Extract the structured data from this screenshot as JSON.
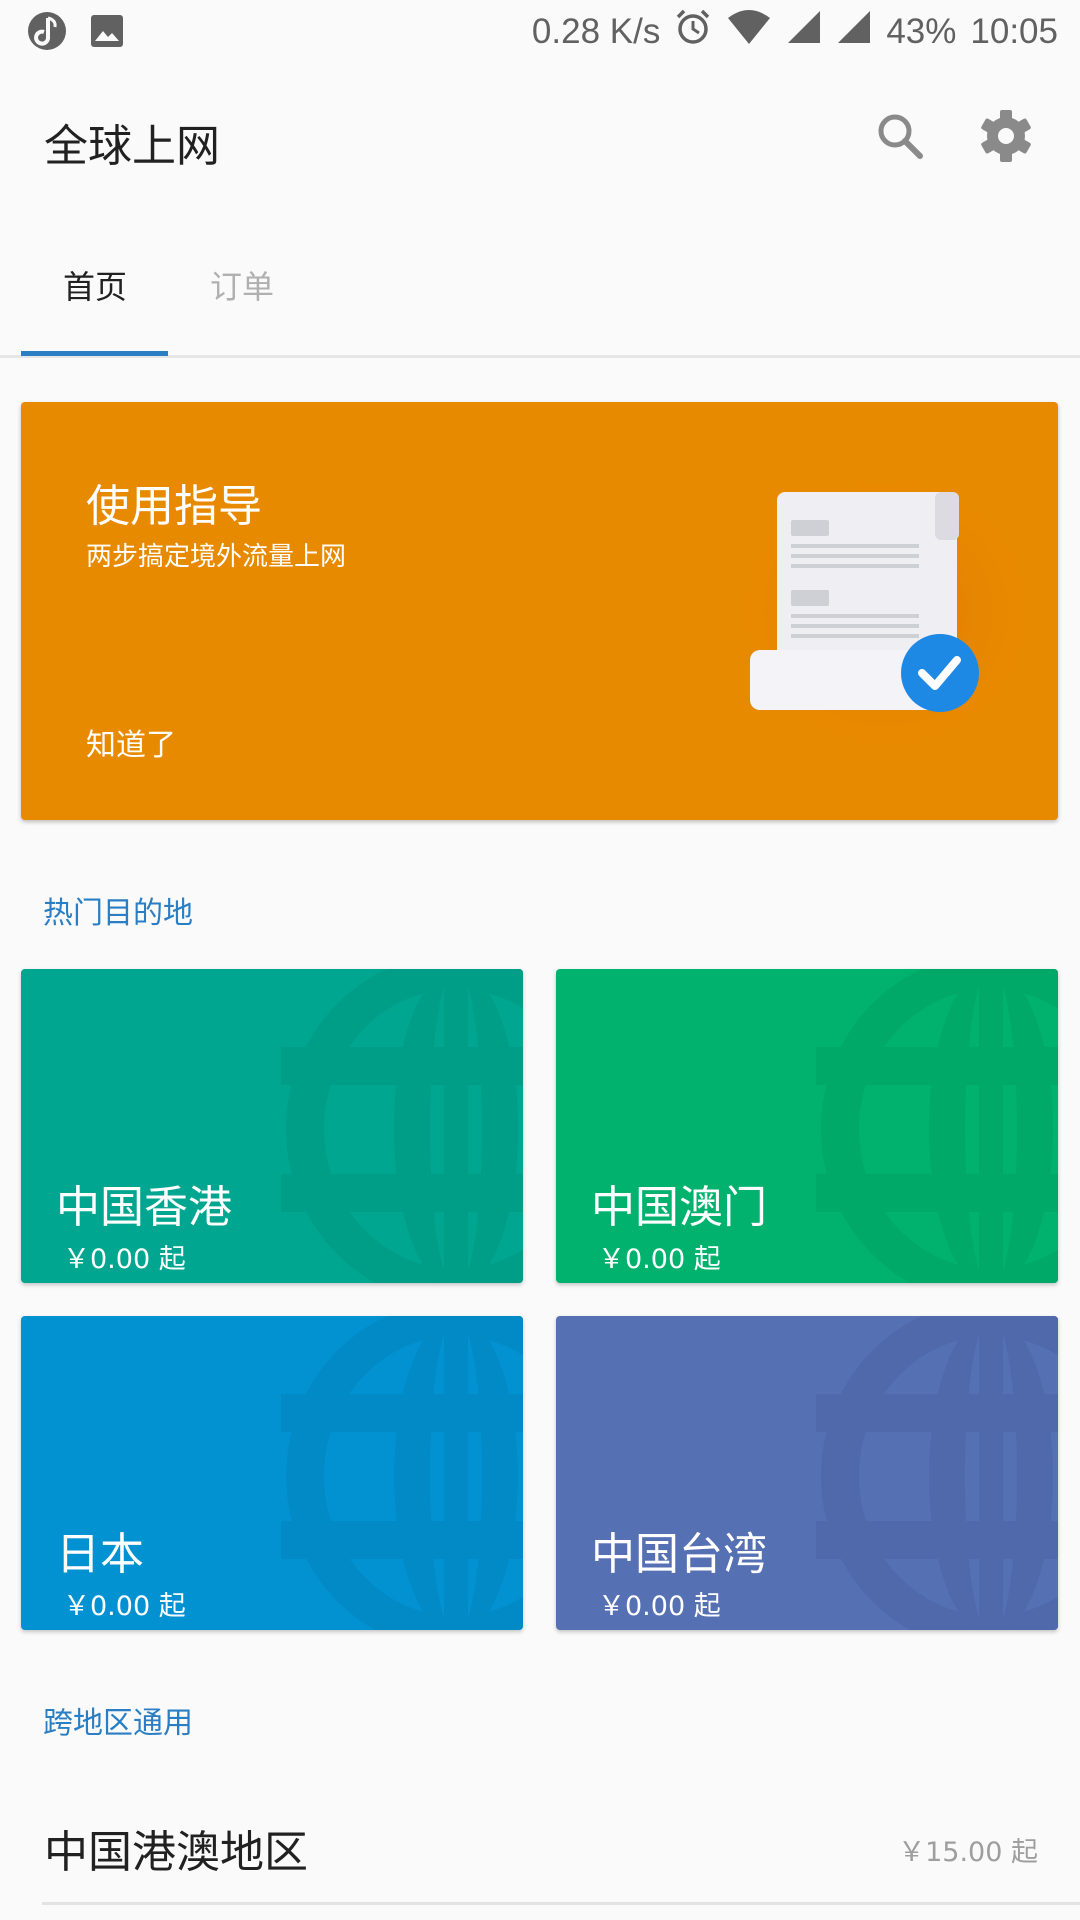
{
  "status_bar": {
    "left_icons": [
      "music-app-icon",
      "image-icon"
    ],
    "net_speed": "0.28 K/s",
    "icons": [
      "alarm-icon",
      "wifi-icon",
      "signal-icon",
      "signal-icon"
    ],
    "battery": "43%",
    "time": "10:05"
  },
  "app_bar": {
    "title": "全球上网",
    "actions": [
      "search-icon",
      "gear-icon"
    ]
  },
  "tabs": [
    {
      "label": "首页",
      "selected": true
    },
    {
      "label": "订单",
      "selected": false
    }
  ],
  "guide_card": {
    "title": "使用指导",
    "subtitle": "两步搞定境外流量上网",
    "dismiss_label": "知道了",
    "background": "#e88a00"
  },
  "hot_section": {
    "label": "热门目的地",
    "destinations": [
      {
        "name": "中国香港",
        "price": "￥0.00 起",
        "color": "#00a68f",
        "shade": "#009d87"
      },
      {
        "name": "中国澳门",
        "price": "￥0.00 起",
        "color": "#00b26e",
        "shade": "#00a968"
      },
      {
        "name": "日本",
        "price": "￥0.00 起",
        "color": "#0292d2",
        "shade": "#028ac7"
      },
      {
        "name": "中国台湾",
        "price": "￥0.00 起",
        "color": "#5670b4",
        "shade": "#5069aa"
      }
    ]
  },
  "cross_section": {
    "label": "跨地区通用",
    "items": [
      {
        "name": "中国港澳地区",
        "price": "￥15.00 起"
      }
    ]
  },
  "accent_color": "#2a7fc4"
}
